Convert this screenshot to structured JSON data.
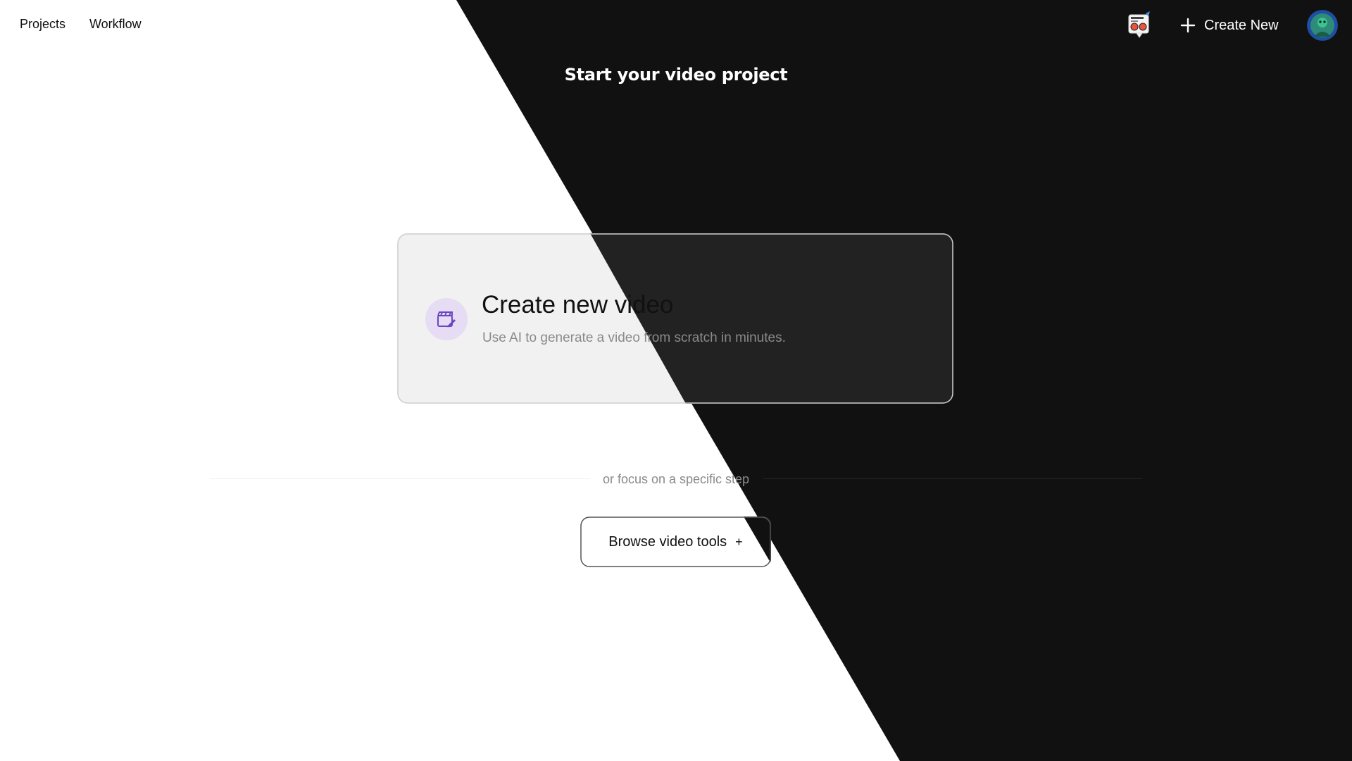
{
  "nav": {
    "projects_label": "Projects",
    "workflow_label": "Workflow"
  },
  "header": {
    "news_icon": "newspaper-megaphone-icon",
    "create_new_label": "Create New",
    "create_new_icon": "plus-icon",
    "avatar_icon": "user-avatar"
  },
  "main": {
    "title": "Start your video project",
    "card": {
      "icon": "clapperboard-edit-icon",
      "title": "Create new video",
      "description": "Use AI to generate a video from scratch in minutes."
    },
    "divider_text": "or focus on a specific step",
    "browse_button_label": "Browse video tools",
    "browse_button_suffix": "+"
  },
  "colors": {
    "light_bg": "#ffffff",
    "dark_bg": "#111111",
    "card_light": "#f1f1f1",
    "card_dark": "#222222",
    "icon_accent": "#6b46c1",
    "icon_circle": "#e6dcf4"
  }
}
